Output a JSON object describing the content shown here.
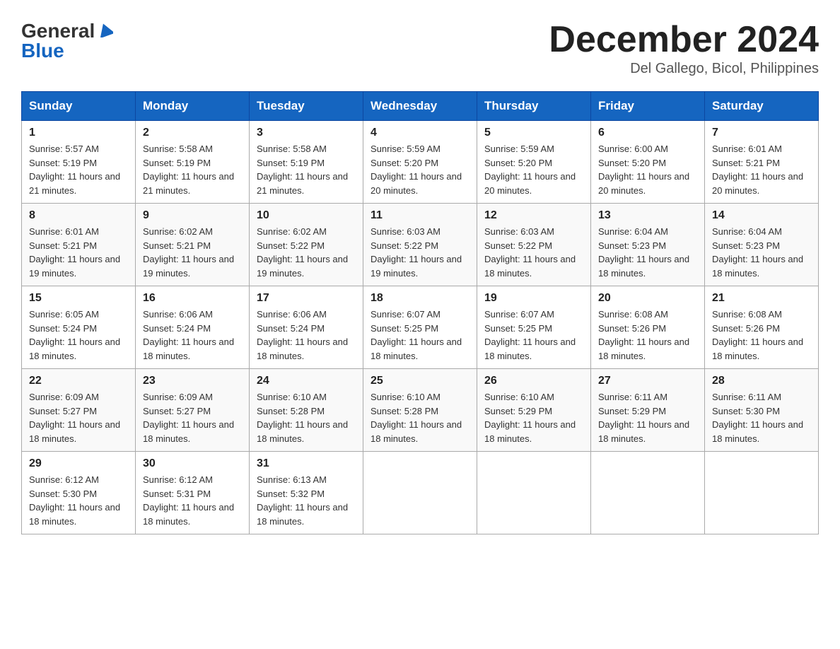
{
  "header": {
    "logo_text1": "General",
    "logo_text2": "Blue",
    "month_title": "December 2024",
    "location": "Del Gallego, Bicol, Philippines"
  },
  "days_of_week": [
    "Sunday",
    "Monday",
    "Tuesday",
    "Wednesday",
    "Thursday",
    "Friday",
    "Saturday"
  ],
  "weeks": [
    [
      {
        "day": "1",
        "sunrise": "5:57 AM",
        "sunset": "5:19 PM",
        "daylight": "11 hours and 21 minutes."
      },
      {
        "day": "2",
        "sunrise": "5:58 AM",
        "sunset": "5:19 PM",
        "daylight": "11 hours and 21 minutes."
      },
      {
        "day": "3",
        "sunrise": "5:58 AM",
        "sunset": "5:19 PM",
        "daylight": "11 hours and 21 minutes."
      },
      {
        "day": "4",
        "sunrise": "5:59 AM",
        "sunset": "5:20 PM",
        "daylight": "11 hours and 20 minutes."
      },
      {
        "day": "5",
        "sunrise": "5:59 AM",
        "sunset": "5:20 PM",
        "daylight": "11 hours and 20 minutes."
      },
      {
        "day": "6",
        "sunrise": "6:00 AM",
        "sunset": "5:20 PM",
        "daylight": "11 hours and 20 minutes."
      },
      {
        "day": "7",
        "sunrise": "6:01 AM",
        "sunset": "5:21 PM",
        "daylight": "11 hours and 20 minutes."
      }
    ],
    [
      {
        "day": "8",
        "sunrise": "6:01 AM",
        "sunset": "5:21 PM",
        "daylight": "11 hours and 19 minutes."
      },
      {
        "day": "9",
        "sunrise": "6:02 AM",
        "sunset": "5:21 PM",
        "daylight": "11 hours and 19 minutes."
      },
      {
        "day": "10",
        "sunrise": "6:02 AM",
        "sunset": "5:22 PM",
        "daylight": "11 hours and 19 minutes."
      },
      {
        "day": "11",
        "sunrise": "6:03 AM",
        "sunset": "5:22 PM",
        "daylight": "11 hours and 19 minutes."
      },
      {
        "day": "12",
        "sunrise": "6:03 AM",
        "sunset": "5:22 PM",
        "daylight": "11 hours and 18 minutes."
      },
      {
        "day": "13",
        "sunrise": "6:04 AM",
        "sunset": "5:23 PM",
        "daylight": "11 hours and 18 minutes."
      },
      {
        "day": "14",
        "sunrise": "6:04 AM",
        "sunset": "5:23 PM",
        "daylight": "11 hours and 18 minutes."
      }
    ],
    [
      {
        "day": "15",
        "sunrise": "6:05 AM",
        "sunset": "5:24 PM",
        "daylight": "11 hours and 18 minutes."
      },
      {
        "day": "16",
        "sunrise": "6:06 AM",
        "sunset": "5:24 PM",
        "daylight": "11 hours and 18 minutes."
      },
      {
        "day": "17",
        "sunrise": "6:06 AM",
        "sunset": "5:24 PM",
        "daylight": "11 hours and 18 minutes."
      },
      {
        "day": "18",
        "sunrise": "6:07 AM",
        "sunset": "5:25 PM",
        "daylight": "11 hours and 18 minutes."
      },
      {
        "day": "19",
        "sunrise": "6:07 AM",
        "sunset": "5:25 PM",
        "daylight": "11 hours and 18 minutes."
      },
      {
        "day": "20",
        "sunrise": "6:08 AM",
        "sunset": "5:26 PM",
        "daylight": "11 hours and 18 minutes."
      },
      {
        "day": "21",
        "sunrise": "6:08 AM",
        "sunset": "5:26 PM",
        "daylight": "11 hours and 18 minutes."
      }
    ],
    [
      {
        "day": "22",
        "sunrise": "6:09 AM",
        "sunset": "5:27 PM",
        "daylight": "11 hours and 18 minutes."
      },
      {
        "day": "23",
        "sunrise": "6:09 AM",
        "sunset": "5:27 PM",
        "daylight": "11 hours and 18 minutes."
      },
      {
        "day": "24",
        "sunrise": "6:10 AM",
        "sunset": "5:28 PM",
        "daylight": "11 hours and 18 minutes."
      },
      {
        "day": "25",
        "sunrise": "6:10 AM",
        "sunset": "5:28 PM",
        "daylight": "11 hours and 18 minutes."
      },
      {
        "day": "26",
        "sunrise": "6:10 AM",
        "sunset": "5:29 PM",
        "daylight": "11 hours and 18 minutes."
      },
      {
        "day": "27",
        "sunrise": "6:11 AM",
        "sunset": "5:29 PM",
        "daylight": "11 hours and 18 minutes."
      },
      {
        "day": "28",
        "sunrise": "6:11 AM",
        "sunset": "5:30 PM",
        "daylight": "11 hours and 18 minutes."
      }
    ],
    [
      {
        "day": "29",
        "sunrise": "6:12 AM",
        "sunset": "5:30 PM",
        "daylight": "11 hours and 18 minutes."
      },
      {
        "day": "30",
        "sunrise": "6:12 AM",
        "sunset": "5:31 PM",
        "daylight": "11 hours and 18 minutes."
      },
      {
        "day": "31",
        "sunrise": "6:13 AM",
        "sunset": "5:32 PM",
        "daylight": "11 hours and 18 minutes."
      },
      null,
      null,
      null,
      null
    ]
  ],
  "labels": {
    "sunrise_prefix": "Sunrise: ",
    "sunset_prefix": "Sunset: ",
    "daylight_prefix": "Daylight: "
  }
}
